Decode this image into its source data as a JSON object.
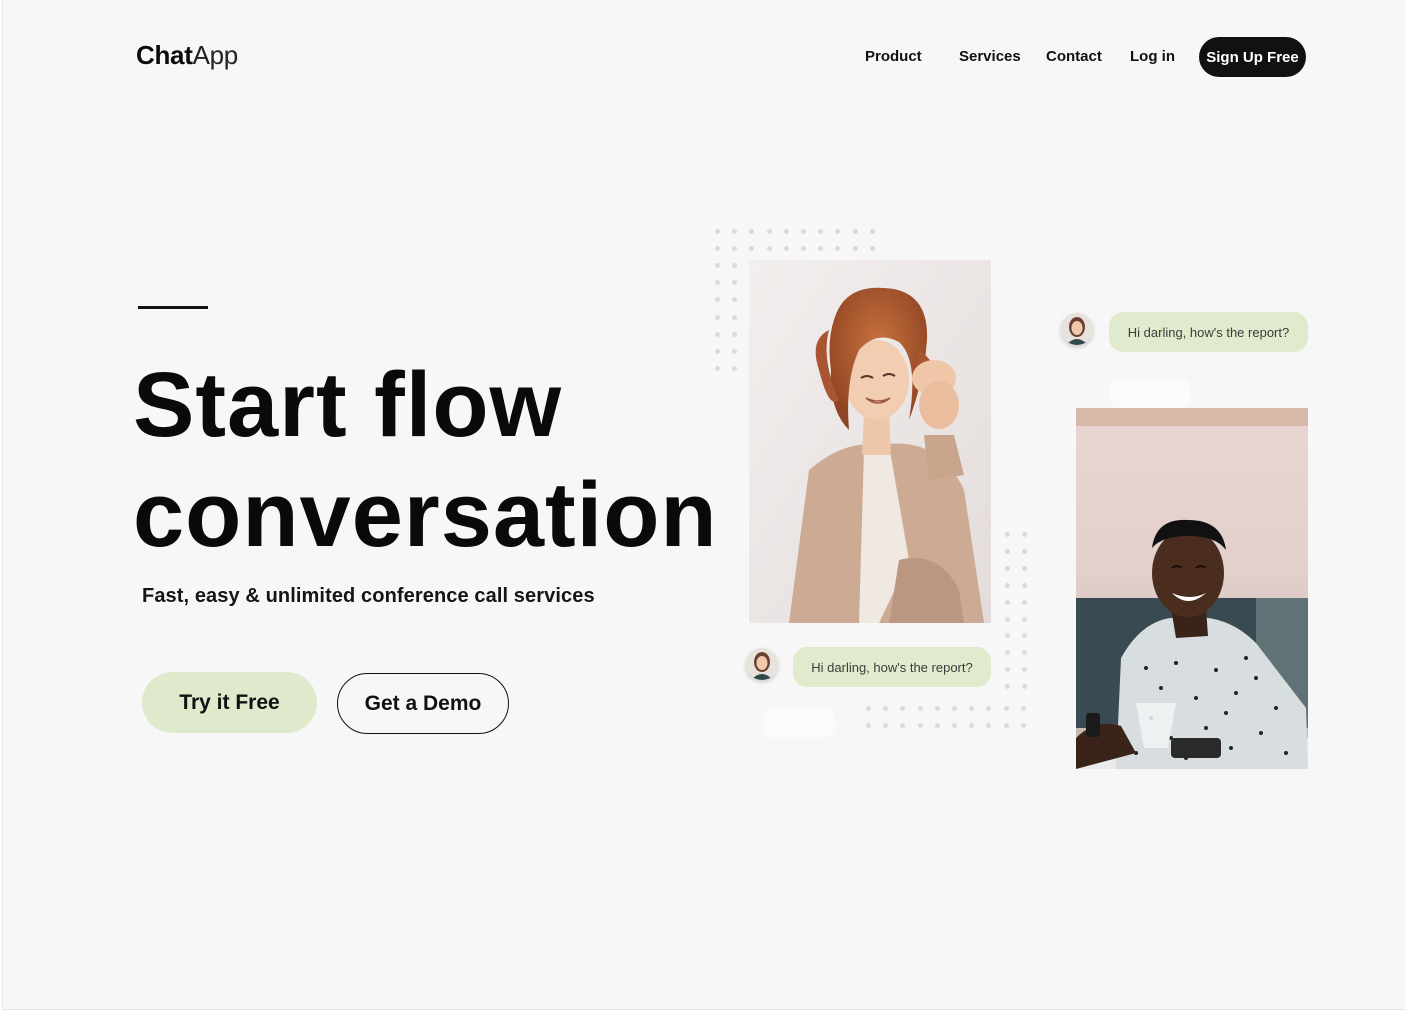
{
  "brand": {
    "bold": "Chat",
    "light": "App"
  },
  "nav": {
    "items": [
      "Product",
      "Services",
      "Contact",
      "Log in"
    ],
    "signup_label": "Sign Up Free"
  },
  "hero": {
    "title_line1": "Start flow",
    "title_line2": "conversation",
    "subtitle": "Fast, easy & unlimited conference call services",
    "primary_button": "Try it Free",
    "secondary_button": "Get a Demo"
  },
  "chats": [
    {
      "message": "Hi darling, how's the report?"
    },
    {
      "message": "Hi darling, how's the report?"
    }
  ],
  "colors": {
    "background": "#f7f7f7",
    "accent_green": "#deeacb",
    "bubble_green": "#e0ebcd",
    "dark": "#111111",
    "dot": "#dadada"
  },
  "icons": {
    "photo_woman": "photo-woman-laughing",
    "photo_man": "photo-man-smiling",
    "avatar": "user-avatar-icon"
  }
}
